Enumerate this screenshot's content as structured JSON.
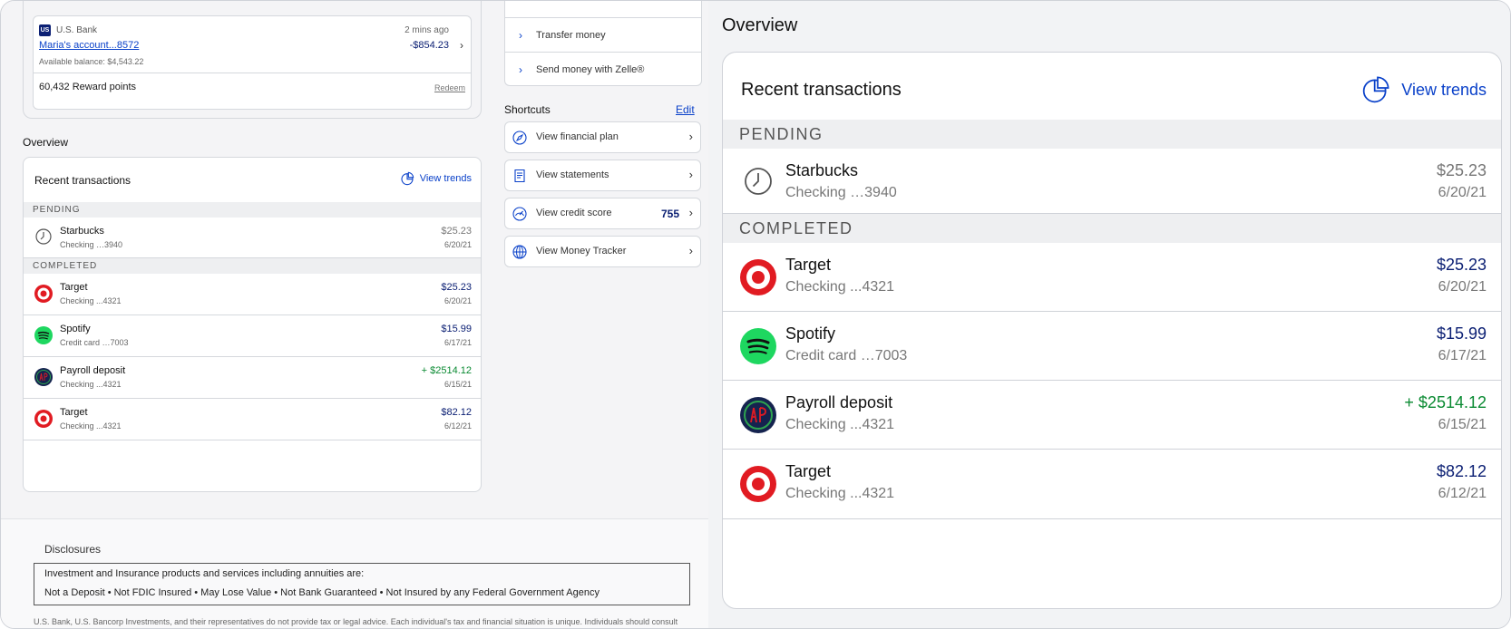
{
  "account": {
    "bank_name": "U.S. Bank",
    "bank_logo_text": "US",
    "time": "2 mins ago",
    "name": "Maria's account...8572",
    "amount": "-$854.23",
    "available_balance": "Available balance: $4,543.22",
    "reward_points": "60,432 Reward points",
    "redeem_label": "Redeem"
  },
  "actions": [
    {
      "label": "Transfer money"
    },
    {
      "label": "Send money with Zelle®"
    }
  ],
  "shortcuts": {
    "title": "Shortcuts",
    "edit_label": "Edit",
    "items": [
      {
        "label": "View financial plan",
        "icon": "compass-icon"
      },
      {
        "label": "View statements",
        "icon": "document-icon"
      },
      {
        "label": "View credit score",
        "icon": "gauge-icon",
        "score": "755"
      },
      {
        "label": "View Money Tracker",
        "icon": "globe-icon"
      }
    ]
  },
  "overview": {
    "title": "Overview",
    "card_title": "Recent transactions",
    "view_trends": "View trends",
    "pending_label": "PENDING",
    "completed_label": "COMPLETED",
    "pending": [
      {
        "name": "Starbucks",
        "account": "Checking …3940",
        "amount": "$25.23",
        "date": "6/20/21",
        "icon": "clock-icon"
      }
    ],
    "completed": [
      {
        "name": "Target",
        "account": "Checking ...4321",
        "amount": "$25.23",
        "date": "6/20/21",
        "icon": "target-logo-icon"
      },
      {
        "name": "Spotify",
        "account": "Credit card …7003",
        "amount": "$15.99",
        "date": "6/17/21",
        "icon": "spotify-logo-icon"
      },
      {
        "name": "Payroll deposit",
        "account": "Checking ...4321",
        "amount": "+ $2514.12",
        "date": "6/15/21",
        "icon": "payroll-logo-icon"
      },
      {
        "name": "Target",
        "account": "Checking ...4321",
        "amount": "$82.12",
        "date": "6/12/21",
        "icon": "target-logo-icon"
      }
    ]
  },
  "disclosures": {
    "title": "Disclosures",
    "box_line1": "Investment and Insurance products and services including annuities are:",
    "box_line2": "Not a Deposit • Not FDIC Insured • May Lose Value • Not Bank Guaranteed • Not Insured by any Federal Government Agency",
    "small_text": "U.S. Bank, U.S. Bancorp Investments, and their representatives do not provide tax or legal advice. Each individual's tax and financial situation is unique. Individuals should consult"
  },
  "colors": {
    "link_blue": "#0a41c9",
    "amount_navy": "#0c2074",
    "credit_green": "#0a8a32",
    "target_red": "#e11b22",
    "spotify_green": "#1ed760"
  }
}
